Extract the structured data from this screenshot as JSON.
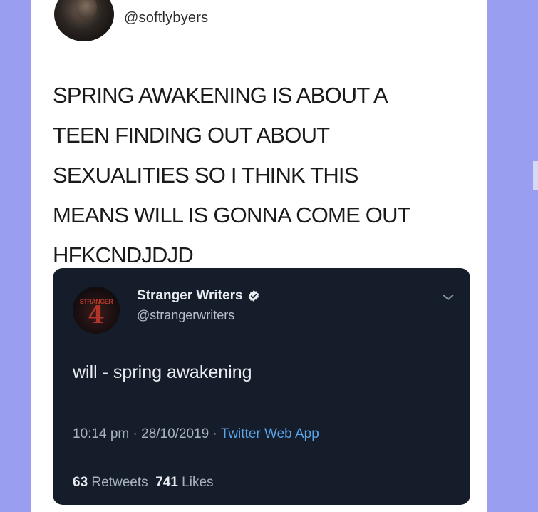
{
  "tweet": {
    "handle": "@softlybyers",
    "text": "SPRING AWAKENING IS ABOUT A\nTEEN FINDING OUT ABOUT\nSEXUALITIES SO I THINK THIS\nMEANS WILL IS GONNA COME OUT\nHFKCNDJDJD"
  },
  "quoted_tweet": {
    "name": "Stranger Writers",
    "handle": "@strangerwriters",
    "text": "will - spring awakening",
    "time": "10:14 pm",
    "date": "28/10/2019",
    "source": "Twitter Web App",
    "retweets_count": "63",
    "retweets_label": "Retweets",
    "likes_count": "741",
    "likes_label": "Likes",
    "avatar_logo_text": "STRANGER",
    "avatar_logo_number": "4"
  },
  "colors": {
    "background": "#9a9ef0",
    "card": "#ffffff",
    "quote_bg": "#151d2a",
    "link": "#5aa4ea"
  },
  "icons": {
    "verified": "verified-badge-icon",
    "menu": "chevron-down-icon"
  }
}
